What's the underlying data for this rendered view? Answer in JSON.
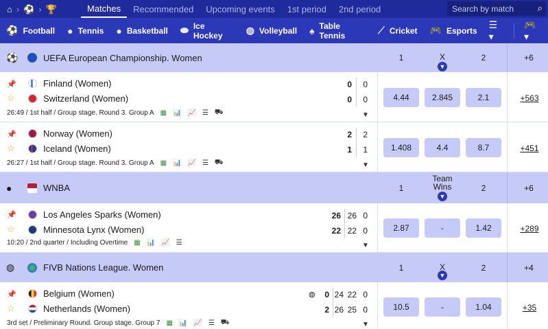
{
  "topnav": {
    "tabs": [
      "Matches",
      "Recommended",
      "Upcoming events",
      "1st period",
      "2nd period"
    ],
    "search_placeholder": "Search by match"
  },
  "sports": [
    "Football",
    "Tennis",
    "Basketball",
    "Ice Hockey",
    "Volleyball",
    "Table Tennis",
    "Cricket",
    "Esports"
  ],
  "leagues": {
    "uefa": {
      "name": "UEFA European Championship. Women",
      "h1": "1",
      "hx": "X",
      "h2": "2",
      "more": "+6"
    },
    "wnba": {
      "name": "WNBA",
      "h1": "1",
      "hx": "Team Wins",
      "h2": "2",
      "more": "+6"
    },
    "fivb": {
      "name": "FIVB Nations League. Women",
      "h1": "1",
      "hx": "X",
      "h2": "2",
      "more": "+4"
    }
  },
  "matches": {
    "m1": {
      "team1": "Finland (Women)",
      "team2": "Switzerland (Women)",
      "s1a": "0",
      "s1b": "0",
      "s2a": "0",
      "s2b": "0",
      "info": "26:49 / 1st half / Group stage. Round 3. Group A",
      "o1": "4.44",
      "ox": "2.845",
      "o2": "2.1",
      "more": "+563"
    },
    "m2": {
      "team1": "Norway (Women)",
      "team2": "Iceland (Women)",
      "s1a": "2",
      "s1b": "2",
      "s2a": "1",
      "s2b": "1",
      "info": "26:27 / 1st half / Group stage. Round 3. Group A",
      "o1": "1.408",
      "ox": "4.4",
      "o2": "8.7",
      "more": "+451"
    },
    "m3": {
      "team1": "Los Angeles Sparks (Women)",
      "team2": "Minnesota Lynx (Women)",
      "s1a": "26",
      "s1b": "26",
      "s1c": "0",
      "s2a": "22",
      "s2b": "22",
      "s2c": "0",
      "info": "10:20 / 2nd quarter / Including Overtime",
      "o1": "2.87",
      "ox": "-",
      "o2": "1.42",
      "more": "+289"
    },
    "m4": {
      "team1": "Belgium (Women)",
      "team2": "Netherlands (Women)",
      "s1a": "0",
      "s1b": "24",
      "s1c": "22",
      "s1d": "0",
      "s2a": "2",
      "s2b": "26",
      "s2c": "25",
      "s2d": "0",
      "info": "3rd set / Preliminary Round. Group stage. Group 7",
      "o1": "10.5",
      "ox": "-",
      "o2": "1.04",
      "more": "+35"
    }
  },
  "colors": {
    "topbar": "#1f2a9b",
    "sportsbar": "#2b38b8",
    "league_bg": "#c5cbf6",
    "odd_bg": "#c5cbf6"
  }
}
